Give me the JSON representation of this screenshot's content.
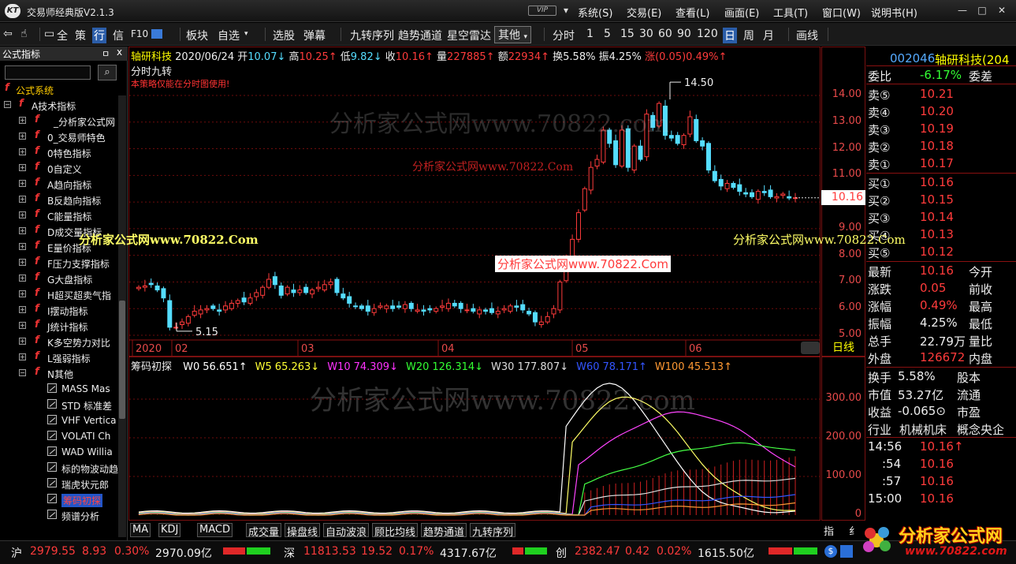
{
  "window": {
    "title": "交易师经典版V2.1.3",
    "logo": "KT",
    "vip": "VIP",
    "menu": [
      "系统(S)",
      "交易(E)",
      "查看(L)",
      "画面(E)",
      "工具(T)",
      "窗口(W)",
      "说明书(H)"
    ]
  },
  "toolbar": {
    "items": [
      "全",
      "策",
      "行",
      "信",
      "F10",
      "板块",
      "自选",
      "选股",
      "弹幕",
      "九转序列",
      "趋势通道",
      "星空雷达",
      "其他",
      "分时",
      "1",
      "5",
      "15",
      "30",
      "60",
      "90",
      "120",
      "日",
      "周",
      "月",
      "画线"
    ],
    "selected": [
      "行",
      "日"
    ]
  },
  "left_panel": {
    "title": "公式指标",
    "pin": "ㅁ",
    "close": "x",
    "search_placeholder": "",
    "root": "公式系统",
    "group": "A技术指标",
    "items": [
      "_分析家公式网",
      "0_交易师特色",
      "0特色指标",
      "0自定义",
      "A趋向指标",
      "B反趋向指标",
      "C能量指标",
      "D成交量指标",
      "E量价指标",
      "F压力支撑指标",
      "G大盘指标",
      "H超买超卖气指",
      "I摆动指标",
      "J统计指标",
      "K多空势力对比",
      "L强弱指标",
      "N其他"
    ],
    "sub_items": [
      "MASS Mas",
      "STD 标准差",
      "VHF Vertica",
      "VOLATI Ch",
      "WAD Willia",
      "标的物波动趋",
      "瑞虎状元郎",
      "筹码初探",
      "频谱分析"
    ],
    "selected_sub": "筹码初探"
  },
  "stock_header": {
    "name": "轴研科技",
    "date": "2020/06/24",
    "open_label": "开",
    "open": "10.07↓",
    "high_label": "高",
    "high": "10.25↑",
    "low_label": "低",
    "low": "9.82↓",
    "close_label": "收",
    "close": "10.16↑",
    "vol_label": "量",
    "vol": "227885↑",
    "amt_label": "额",
    "amt": "22934↑",
    "turnover_label": "换",
    "turnover": "5.58%",
    "amp_label": "振",
    "amp": "4.25%",
    "chg_label": "涨",
    "chg": "(0.05)0.49%↑"
  },
  "chart_top": {
    "subtitle": "分时九转",
    "warning": "本策略仅能在分时图使用!",
    "max_label": "14.50",
    "min_label": "5.15",
    "current_price": "10.16",
    "period": "日线",
    "price_ticks": [
      "14.00",
      "13.00",
      "12.00",
      "11.00",
      "10.00",
      "9.00",
      "8.00",
      "7.00",
      "6.00",
      "5.00"
    ],
    "months": [
      "2020",
      "02",
      "03",
      "04",
      "05",
      "06"
    ]
  },
  "chart_bottom": {
    "name": "筹码初探",
    "series": [
      {
        "label": "W0",
        "value": "56.651↑",
        "color": "#ffffff"
      },
      {
        "label": "W5",
        "value": "65.263↓",
        "color": "#ffff33"
      },
      {
        "label": "W10",
        "value": "74.309↓",
        "color": "#ff33ff"
      },
      {
        "label": "W20",
        "value": "126.314↓",
        "color": "#33ff33"
      },
      {
        "label": "W30",
        "value": "177.807↓",
        "color": "#dddddd"
      },
      {
        "label": "W60",
        "value": "78.171↑",
        "color": "#3355ff"
      },
      {
        "label": "W100",
        "value": "45.513↑",
        "color": "#ff9933"
      }
    ],
    "ticks": [
      "300.00",
      "200.00",
      "100.00",
      "0"
    ]
  },
  "bottom_tabs": [
    "MA",
    "KDJ",
    "MACD",
    "成交量",
    "操盘线",
    "自动波浪",
    "顾比均线",
    "趋势通道",
    "九转序列"
  ],
  "right_edge_tabs": [
    "指",
    "纟"
  ],
  "watermarks": [
    "分析家公式网www.70822.com",
    "分析家公式网www.70822.Com",
    "分析家公式网www.70822.Com",
    "分析家公式网www.70822.Com",
    "分析家公式网www.70822.Com",
    "分析家公式网www.70822.com"
  ],
  "right_panel": {
    "code": "002046",
    "name": "轴研科技(204",
    "weibi_label": "委比",
    "weibi": "-6.17%",
    "weicha_label": "委差",
    "asks": [
      {
        "label": "卖⑤",
        "price": "10.21"
      },
      {
        "label": "卖④",
        "price": "10.20"
      },
      {
        "label": "卖③",
        "price": "10.19"
      },
      {
        "label": "卖②",
        "price": "10.18"
      },
      {
        "label": "卖①",
        "price": "10.17"
      }
    ],
    "bids": [
      {
        "label": "买①",
        "price": "10.16"
      },
      {
        "label": "买②",
        "price": "10.15"
      },
      {
        "label": "买③",
        "price": "10.14"
      },
      {
        "label": "买④",
        "price": "10.13"
      },
      {
        "label": "买⑤",
        "price": "10.12"
      }
    ],
    "stats": [
      {
        "l1": "最新",
        "v1": "10.16",
        "l2": "今开"
      },
      {
        "l1": "涨跌",
        "v1": "0.05",
        "l2": "前收"
      },
      {
        "l1": "涨幅",
        "v1": "0.49%",
        "l2": "最高"
      },
      {
        "l1": "振幅",
        "v1": "4.25%",
        "l2": "最低"
      },
      {
        "l1": "总手",
        "v1": "22.79万",
        "l2": "量比"
      },
      {
        "l1": "外盘",
        "v1": "126672",
        "l2": "内盘"
      }
    ],
    "stats2": [
      {
        "l1": "换手",
        "v1": "5.58%",
        "l2": "股本"
      },
      {
        "l1": "市值",
        "v1": "53.27亿",
        "l2": "流通"
      },
      {
        "l1": "收益",
        "v1": "-0.065⊙",
        "l2": "市盈"
      },
      {
        "l1": "行业",
        "v1": "机械机床",
        "l2": "概念央企"
      }
    ],
    "ticks": [
      {
        "t": "14:56",
        "p": "10.16↑"
      },
      {
        "t": ":54",
        "p": "10.16"
      },
      {
        "t": ":57",
        "p": "10.16"
      },
      {
        "t": "15:00",
        "p": "10.16"
      }
    ]
  },
  "status_bar": {
    "sh_label": "沪",
    "sh_index": "2979.55",
    "sh_chg": "8.93",
    "sh_pct": "0.30%",
    "sh_amt": "2970.09亿",
    "sz_label": "深",
    "sz_index": "11813.53",
    "sz_chg": "19.52",
    "sz_pct": "0.17%",
    "sz_amt": "4317.67亿",
    "cy_label": "创",
    "cy_index": "2382.47",
    "cy_chg": "0.42",
    "cy_pct": "0.02%",
    "cy_amt": "1615.50亿"
  },
  "brand": {
    "name": "分析家公式网",
    "url": "www.70822.com"
  },
  "colors": {
    "up": "#ff3b3b",
    "down": "#55ddff",
    "yellow": "#ffff00",
    "grid": "#8a1010"
  }
}
